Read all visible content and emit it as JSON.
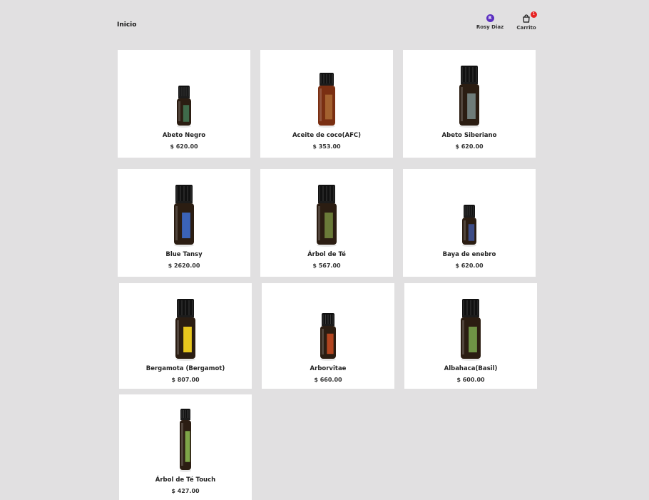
{
  "header": {
    "home_label": "Inicio",
    "user": {
      "initial": "R",
      "name": "Rosy Diaz",
      "avatar_color": "#5b2fc0"
    },
    "cart": {
      "label": "Carrito",
      "count": "1",
      "badge_color": "#e62424"
    }
  },
  "products": [
    {
      "name": "Abeto Negro",
      "price": "$ 620.00",
      "label_color": "#3f6a4a",
      "cap": "black",
      "bottle": "dark",
      "size": "small"
    },
    {
      "name": "Aceite de coco(AFC)",
      "price": "$ 353.00",
      "label_color": "#a3612f",
      "cap": "black",
      "bottle": "amber",
      "size": "tall"
    },
    {
      "name": "Abeto Siberiano",
      "price": "$ 620.00",
      "label_color": "#6f7c79",
      "cap": "black",
      "bottle": "dark",
      "size": "large"
    },
    {
      "name": "Blue Tansy",
      "price": "$ 2620.00",
      "label_color": "#3b63b8",
      "cap": "black",
      "bottle": "dark",
      "size": "large"
    },
    {
      "name": "Árbol de Té",
      "price": "$ 567.00",
      "label_color": "#6a7a38",
      "cap": "black",
      "bottle": "dark",
      "size": "large"
    },
    {
      "name": "Baya de enebro",
      "price": "$ 620.00",
      "label_color": "#3d4c86",
      "cap": "black",
      "bottle": "dark",
      "size": "small"
    },
    {
      "name": "Bergamota (Bergamot)",
      "price": "$ 807.00",
      "label_color": "#e7c61d",
      "cap": "black",
      "bottle": "dark",
      "size": "large"
    },
    {
      "name": "Arborvitae",
      "price": "$ 660.00",
      "label_color": "#b3451f",
      "cap": "black",
      "bottle": "dark",
      "size": "medium"
    },
    {
      "name": "Albahaca(Basil)",
      "price": "$ 600.00",
      "label_color": "#6f9345",
      "cap": "black",
      "bottle": "dark",
      "size": "large"
    },
    {
      "name": "Árbol de Té Touch",
      "price": "$ 427.00",
      "label_color": "#7ea548",
      "cap": "black",
      "bottle": "dark",
      "size": "roller"
    }
  ]
}
